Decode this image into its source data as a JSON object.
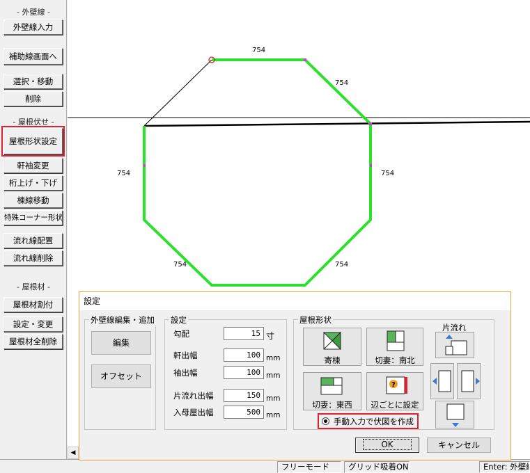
{
  "sidebar": {
    "sec_outer": "- 外壁線 -",
    "btn_outer_input": "外壁線入力",
    "btn_aux_screen": "補助線画面へ",
    "btn_select_move": "選択・移動",
    "btn_delete": "削除",
    "sec_roof_plan": "- 屋根伏せ -",
    "btn_roof_shape": "屋根形状設定",
    "btn_eaves_change": "軒袖変更",
    "btn_beam_updown": "桁上げ・下げ",
    "btn_ridge_move": "棟線移動",
    "btn_special_corner": "特殊コーナー形状",
    "btn_flow_place": "流れ線配置",
    "btn_flow_delete": "流れ線削除",
    "sec_roof_material": "- 屋根材 -",
    "btn_material_split": "屋根材割付",
    "btn_settings_change": "設定・変更",
    "btn_material_delete_all": "屋根材全削除"
  },
  "canvas": {
    "dim_labels": [
      "754",
      "754",
      "754",
      "754",
      "754",
      "754"
    ]
  },
  "status": {
    "mode": "フリーモード",
    "grid": "グリッド吸着ON",
    "hint": "Enter: 外壁線"
  },
  "dialog": {
    "title": "設定",
    "outer_edit": {
      "label": "外壁線編集・追加",
      "edit": "編集",
      "offset": "オフセット"
    },
    "settings": {
      "label": "設定",
      "slope_label": "勾配",
      "slope_value": "15",
      "slope_unit": "寸",
      "eaves_label": "軒出幅",
      "eaves_value": "100",
      "sleeve_label": "袖出幅",
      "sleeve_value": "100",
      "shed_label": "片流れ出幅",
      "shed_value": "150",
      "irimoya_label": "入母屋出幅",
      "irimoya_value": "500",
      "unit": "mm"
    },
    "roof_shape": {
      "label": "屋根形状",
      "hip": "寄棟",
      "gable_ns": "切妻：南北",
      "gable_ew": "切妻：東西",
      "per_edge": "辺ごとに設定",
      "shed_title": "片流れ",
      "manual_option": "手動入力で伏図を作成"
    },
    "ok": "OK",
    "cancel": "キャンセル"
  },
  "colors": {
    "wall_green": "#2ee02e",
    "highlight_red": "#e0202c",
    "dialog_border": "#e8a33c",
    "arrow_blue": "#3a78d8"
  }
}
